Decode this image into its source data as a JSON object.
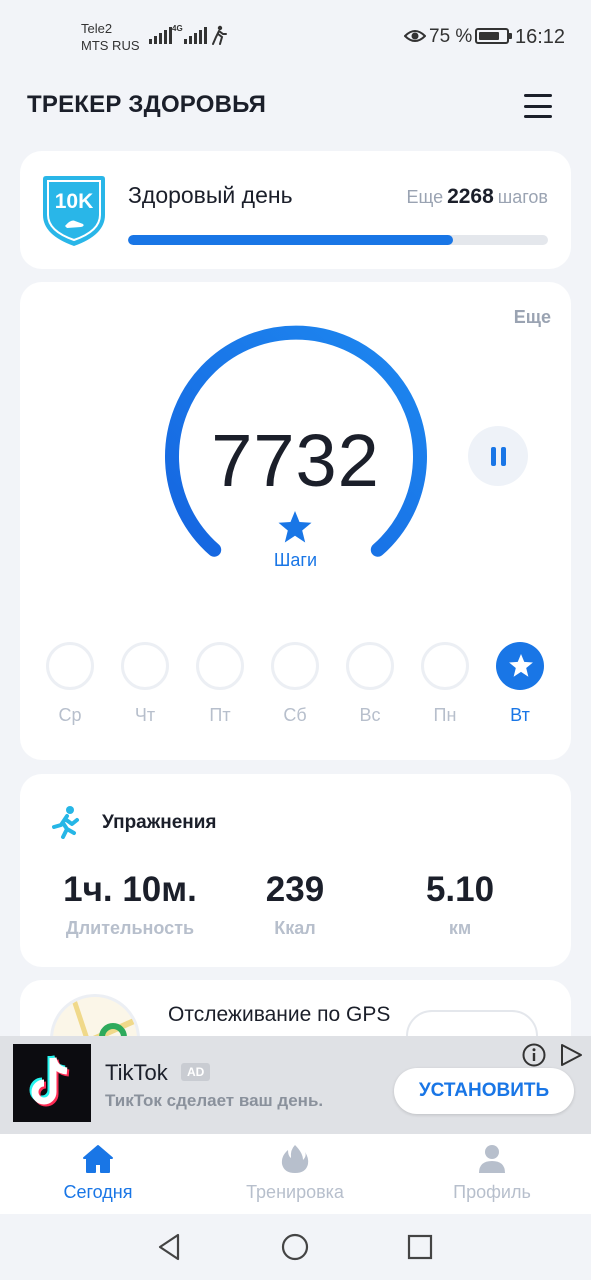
{
  "status_bar": {
    "carrier_1": "Tele2",
    "carrier_2": "MTS RUS",
    "network": "4G",
    "battery_percent": "75 %",
    "time": "16:12"
  },
  "header": {
    "title": "ТРЕКЕР ЗДОРОВЬЯ",
    "menu_icon": "hamburger-menu-icon"
  },
  "goal_card": {
    "badge_text": "10K",
    "title": "Здоровый день",
    "remaining_prefix": "Еще",
    "remaining_value": "2268",
    "remaining_suffix": "шагов",
    "progress_fraction": 0.774,
    "accent_color": "#1976e6"
  },
  "steps_card": {
    "more_label": "Еще",
    "steps_value": "7732",
    "steps_label": "Шаги",
    "pause_icon": "pause-icon",
    "week_days": [
      {
        "label": "Ср",
        "completed": false
      },
      {
        "label": "Чт",
        "completed": false
      },
      {
        "label": "Пт",
        "completed": false
      },
      {
        "label": "Сб",
        "completed": false
      },
      {
        "label": "Вс",
        "completed": false
      },
      {
        "label": "Пн",
        "completed": false
      },
      {
        "label": "Вт",
        "completed": true
      }
    ]
  },
  "exercise_card": {
    "title": "Упражнения",
    "duration_value": "1ч. 10м.",
    "duration_label": "Длительность",
    "kcal_value": "239",
    "kcal_label": "Ккал",
    "distance_value": "5.10",
    "distance_label": "км"
  },
  "gps_card": {
    "title": "Отслеживание по GPS"
  },
  "ad_banner": {
    "app_name": "TikTok",
    "tag": "AD",
    "description": "ТикТок сделает ваш день.",
    "install_label": "УСТАНОВИТЬ"
  },
  "bottom_nav": {
    "items": [
      {
        "label": "Сегодня",
        "icon": "home-icon",
        "active": true
      },
      {
        "label": "Тренировка",
        "icon": "flame-icon",
        "active": false
      },
      {
        "label": "Профиль",
        "icon": "profile-icon",
        "active": false
      }
    ]
  }
}
